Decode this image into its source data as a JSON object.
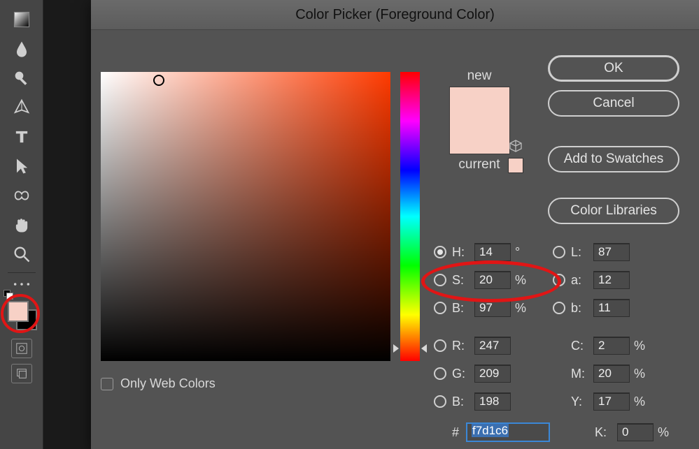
{
  "dialog": {
    "title": "Color Picker (Foreground Color)",
    "buttons": {
      "ok": "OK",
      "cancel": "Cancel",
      "add_swatches": "Add to Swatches",
      "color_libraries": "Color Libraries"
    },
    "preview": {
      "new_label": "new",
      "current_label": "current",
      "new_color": "#f7d1c6",
      "current_color": "#f7d1c6"
    },
    "only_web_colors_label": "Only Web Colors",
    "only_web_colors_checked": false,
    "sv_indicator": {
      "x_pct": 20,
      "y_pct": 3
    },
    "hsb": {
      "h": {
        "label": "H:",
        "value": "14",
        "unit": "°",
        "selected": true
      },
      "s": {
        "label": "S:",
        "value": "20",
        "unit": "%",
        "selected": false
      },
      "b": {
        "label": "B:",
        "value": "97",
        "unit": "%",
        "selected": false
      }
    },
    "lab": {
      "l": {
        "label": "L:",
        "value": "87"
      },
      "a": {
        "label": "a:",
        "value": "12"
      },
      "b": {
        "label": "b:",
        "value": "11"
      }
    },
    "rgb": {
      "r": {
        "label": "R:",
        "value": "247"
      },
      "g": {
        "label": "G:",
        "value": "209"
      },
      "b": {
        "label": "B:",
        "value": "198"
      }
    },
    "cmyk": {
      "c": {
        "label": "C:",
        "value": "2",
        "unit": "%"
      },
      "m": {
        "label": "M:",
        "value": "20",
        "unit": "%"
      },
      "y": {
        "label": "Y:",
        "value": "17",
        "unit": "%"
      },
      "k": {
        "label": "K:",
        "value": "0",
        "unit": "%"
      }
    },
    "hex": {
      "label": "#",
      "value": "f7d1c6"
    }
  },
  "toolbar": {
    "foreground_color": "#f7d1c6",
    "background_color": "#000000"
  }
}
